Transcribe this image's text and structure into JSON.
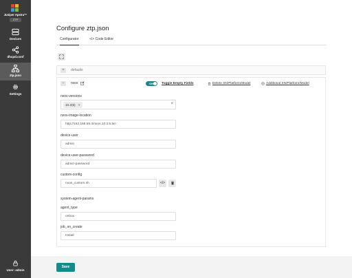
{
  "app": {
    "brand": "Juniper Apstra™",
    "badge": "ZTP"
  },
  "sidebar": {
    "items": [
      {
        "label": "Devices",
        "icon": "devices-icon"
      },
      {
        "label": "dhcpd.conf",
        "icon": "share-icon"
      },
      {
        "label": "ztp.json",
        "icon": "hierarchy-icon"
      },
      {
        "label": "Settings",
        "icon": "gear-icon"
      }
    ],
    "user": {
      "label": "User: admin",
      "icon": "lock-icon"
    }
  },
  "page": {
    "title": "Configure ztp.json",
    "tabs": [
      {
        "label": "Configurator",
        "active": true
      },
      {
        "label": "</> Code Editor",
        "active": false
      }
    ]
  },
  "defaults": {
    "label": "defaults"
  },
  "nxos": {
    "label": "nxos",
    "toggle_on_text": "ON",
    "toggle_label": "Toggle Empty Fields",
    "delete_label": "Delete SN/Platform/Model",
    "additional_label": "Additional SN/Platform/Model",
    "fields": {
      "nxos_versions_label": "nxos-versions",
      "nxos_versions_tag": "10.2(5)",
      "nxos_image_location_label": "nxos-image-location",
      "nxos_image_location_value": "http://192.168.59.4/nxos.10.2.5.bin",
      "device_user_label": "device-user",
      "device_user_value": "admin",
      "device_user_password_label": "device-user-password",
      "device_user_password_value": "admin-password",
      "custom_config_label": "custom-config",
      "custom_config_value": "nxos_custom.sh",
      "system_agent_params_label": "system-agent-params",
      "agent_type_label": "agent_type",
      "agent_type_value": "onbox",
      "job_on_create_label": "job_on_create",
      "job_on_create_value": "Install"
    }
  },
  "footer": {
    "save_label": "Save"
  },
  "colors": {
    "accent": "#16898a",
    "sidebar": "#3a3a3a"
  }
}
